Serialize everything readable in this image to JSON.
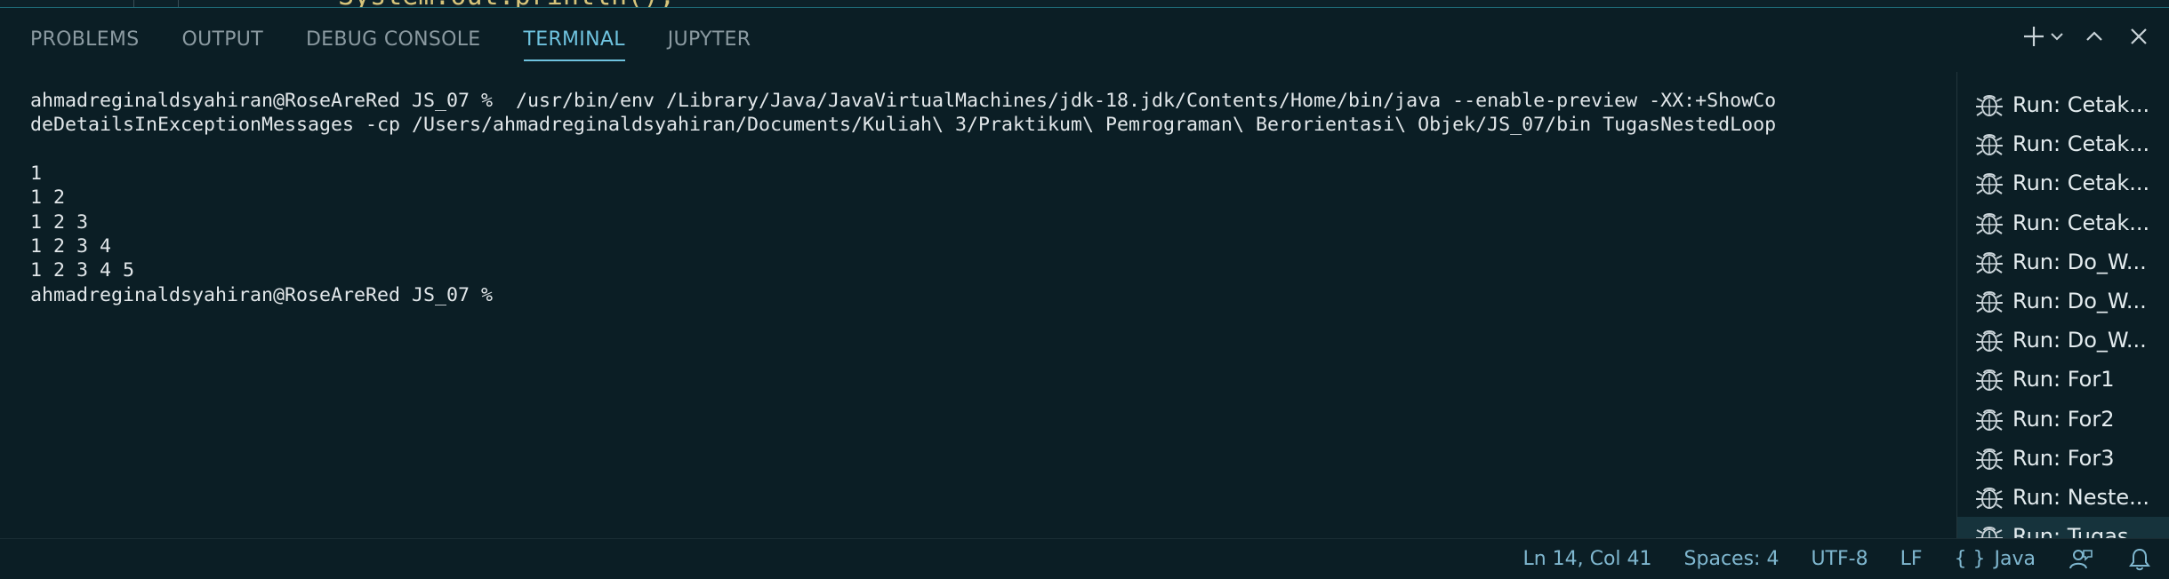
{
  "panel": {
    "tabs": [
      {
        "label": "PROBLEMS",
        "active": false
      },
      {
        "label": "OUTPUT",
        "active": false
      },
      {
        "label": "DEBUG CONSOLE",
        "active": false
      },
      {
        "label": "TERMINAL",
        "active": true
      },
      {
        "label": "JUPYTER",
        "active": false
      }
    ],
    "actions": [
      "plus-icon",
      "chevron-down-icon",
      "chevron-up-icon",
      "close-icon"
    ]
  },
  "terminal": {
    "lines": [
      "ahmadreginaldsyahiran@RoseAreRed JS_07 %  /usr/bin/env /Library/Java/JavaVirtualMachines/jdk-18.jdk/Contents/Home/bin/java --enable-preview -XX:+ShowCo",
      "deDetailsInExceptionMessages -cp /Users/ahmadreginaldsyahiran/Documents/Kuliah\\ 3/Praktikum\\ Pemrograman\\ Berorientasi\\ Objek/JS_07/bin TugasNestedLoop",
      "",
      "1",
      "1 2",
      "1 2 3",
      "1 2 3 4",
      "1 2 3 4 5",
      "ahmadreginaldsyahiran@RoseAreRed JS_07 % "
    ]
  },
  "runs": {
    "icon": "debug-bug-icon",
    "items": [
      {
        "label": "Run: Cetak..."
      },
      {
        "label": "Run: Cetak..."
      },
      {
        "label": "Run: Cetak..."
      },
      {
        "label": "Run: Cetak..."
      },
      {
        "label": "Run: Do_W..."
      },
      {
        "label": "Run: Do_W..."
      },
      {
        "label": "Run: Do_W..."
      },
      {
        "label": "Run: For1"
      },
      {
        "label": "Run: For2"
      },
      {
        "label": "Run: For3"
      },
      {
        "label": "Run: Neste..."
      },
      {
        "label": "Run: Tugas..."
      }
    ],
    "selected_index": 11
  },
  "statusbar": {
    "position": "Ln 14, Col 41",
    "spaces": "Spaces: 4",
    "encoding": "UTF-8",
    "eol": "LF",
    "language_icon": "{ }",
    "language": "Java",
    "feedback_icon": "feedback-person-icon",
    "notifications_icon": "bell-icon"
  },
  "colors": {
    "background": "#0b1e25",
    "accent": "#6fc3df",
    "text": "#e2e7ea",
    "status_text": "#7fb7cf"
  }
}
